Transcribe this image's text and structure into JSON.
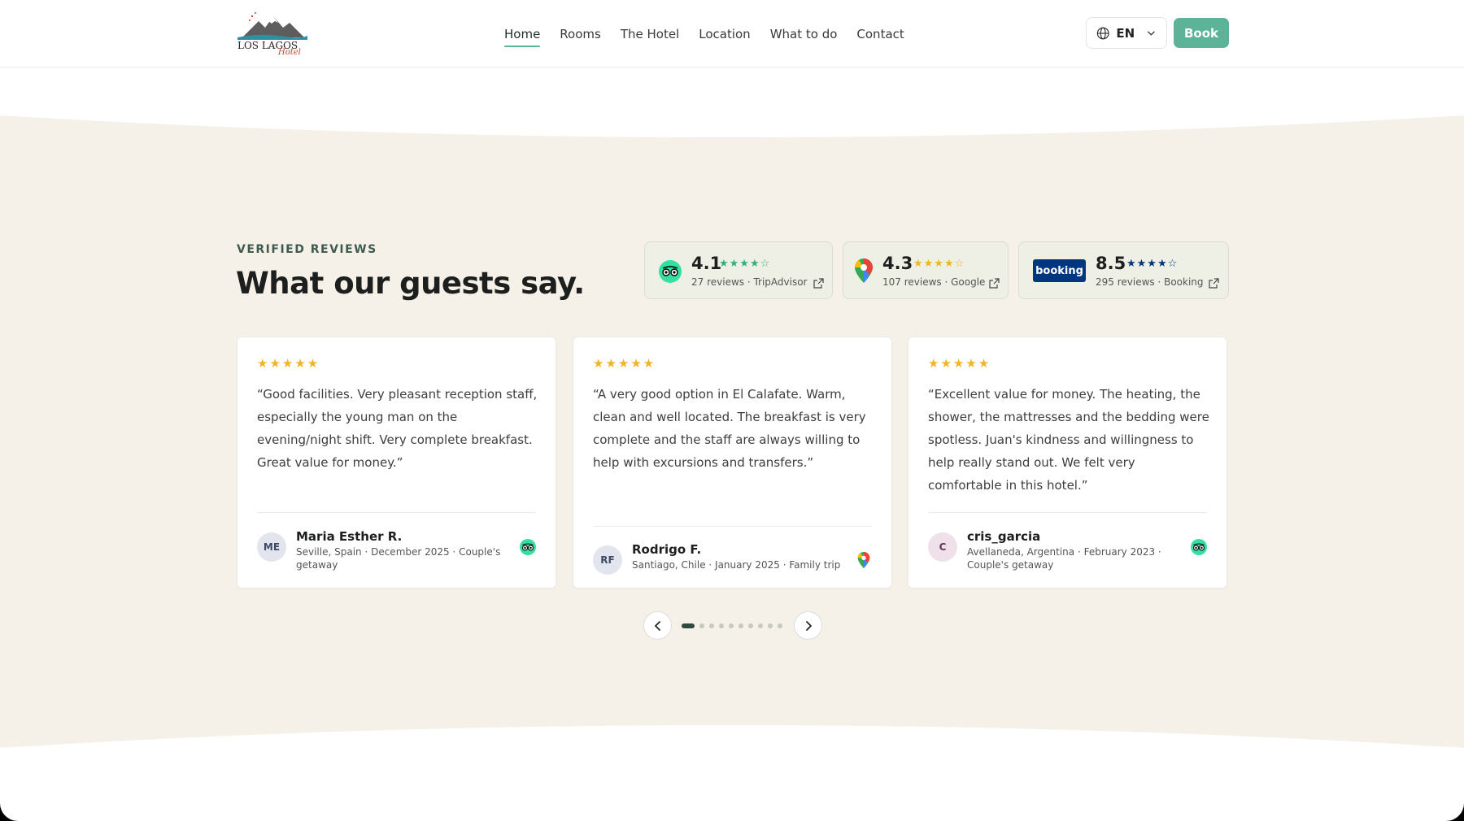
{
  "header": {
    "logo_text": "LOS LAGOS Hotel",
    "nav": [
      {
        "label": "Home",
        "active": true
      },
      {
        "label": "Rooms",
        "active": false
      },
      {
        "label": "The Hotel",
        "active": false
      },
      {
        "label": "Location",
        "active": false
      },
      {
        "label": "What to do",
        "active": false
      },
      {
        "label": "Contact",
        "active": false
      }
    ],
    "language": "EN",
    "book_label": "Book"
  },
  "reviews": {
    "eyebrow": "VERIFIED REVIEWS",
    "title": "What our guests say.",
    "platforms": [
      {
        "name": "TripAdvisor",
        "score": "4.1",
        "stars": 4,
        "summary": "27 reviews · TripAdvisor"
      },
      {
        "name": "Google",
        "score": "4.3",
        "stars": 4,
        "summary": "107 reviews · Google"
      },
      {
        "name": "Booking",
        "score": "8.5",
        "stars": 4,
        "summary": "295 reviews · Booking",
        "badge": "booking"
      }
    ],
    "items": [
      {
        "stars": 5,
        "text": "“Good facilities. Very pleasant reception staff, especially the young man on the evening/night shift. Very complete breakfast. Great value for money.”",
        "initials": "ME",
        "name": "Maria Esther R.",
        "meta": "Seville, Spain · December 2025 · Couple's getaway",
        "source": "tripadvisor"
      },
      {
        "stars": 5,
        "text": "“A very good option in El Calafate. Warm, clean and well located. The breakfast is very complete and the staff are always willing to help with excursions and transfers.”",
        "initials": "RF",
        "name": "Rodrigo F.",
        "meta": "Santiago, Chile · January 2025 · Family trip",
        "source": "google"
      },
      {
        "stars": 5,
        "text": "“Excellent value for money. The heating, the shower, the mattresses and the bedding were spotless. Juan's kindness and willingness to help really stand out. We felt very comfortable in this hotel.”",
        "initials": "C",
        "name": "cris_garcia",
        "meta": "Avellaneda, Argentina · February 2023 · Couple's getaway",
        "source": "tripadvisor"
      }
    ],
    "pagination": {
      "total": 10,
      "current": 1
    }
  },
  "colors": {
    "accent": "#5cb398",
    "section_bg": "#f5f1e8",
    "star_gold": "#f0b429",
    "tripadvisor_green": "#34e0a1",
    "booking_blue": "#003580"
  }
}
